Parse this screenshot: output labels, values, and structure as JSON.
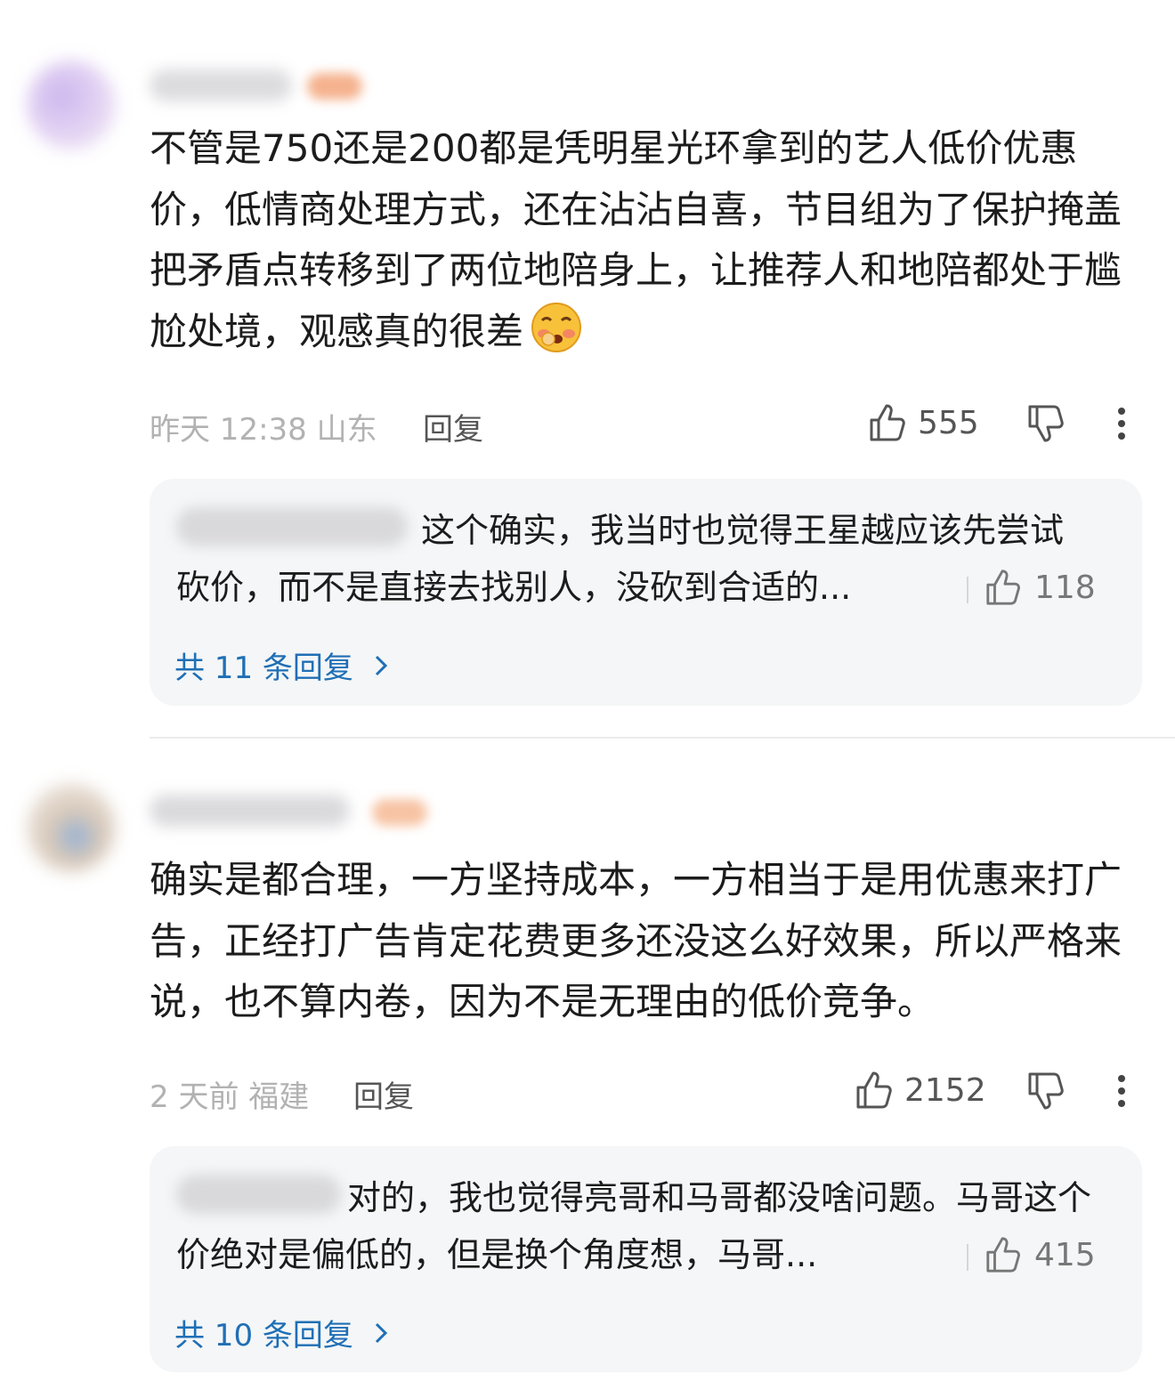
{
  "comments": [
    {
      "text": "不管是750还是200都是凭明星光环拿到的艺人低价优惠价，低情商处理方式，还在沾沾自喜，节目组为了保护掩盖把矛盾点转移到了两位地陪身上，让推荐人和地陪都处于尴尬处境，观感真的很差",
      "emoji": "embarrassed-face",
      "meta": "昨天 12:38 山东",
      "reply_label": "回复",
      "likes": "555",
      "sub_reply": {
        "text": "这个确实，我当时也觉得王星越应该先尝试砍价，而不是直接去找别人，没砍到合适的...",
        "likes": "118"
      },
      "more_replies": "共 11 条回复"
    },
    {
      "text": "确实是都合理，一方坚持成本，一方相当于是用优惠来打广告，正经打广告肯定花费更多还没这么好效果，所以严格来说，也不算内卷，因为不是无理由的低价竞争。",
      "meta": "2 天前  福建",
      "reply_label": "回复",
      "likes": "2152",
      "sub_reply": {
        "text": "对的，我也觉得亮哥和马哥都没啥问题。马哥这个价绝对是偏低的，但是换个角度想，马哥...",
        "likes": "415"
      },
      "more_replies": "共 10 条回复"
    }
  ],
  "colors": {
    "link_blue": "#1f6fb5",
    "meta_gray": "#b2b2b2",
    "sub_bg": "#f4f6f7"
  }
}
